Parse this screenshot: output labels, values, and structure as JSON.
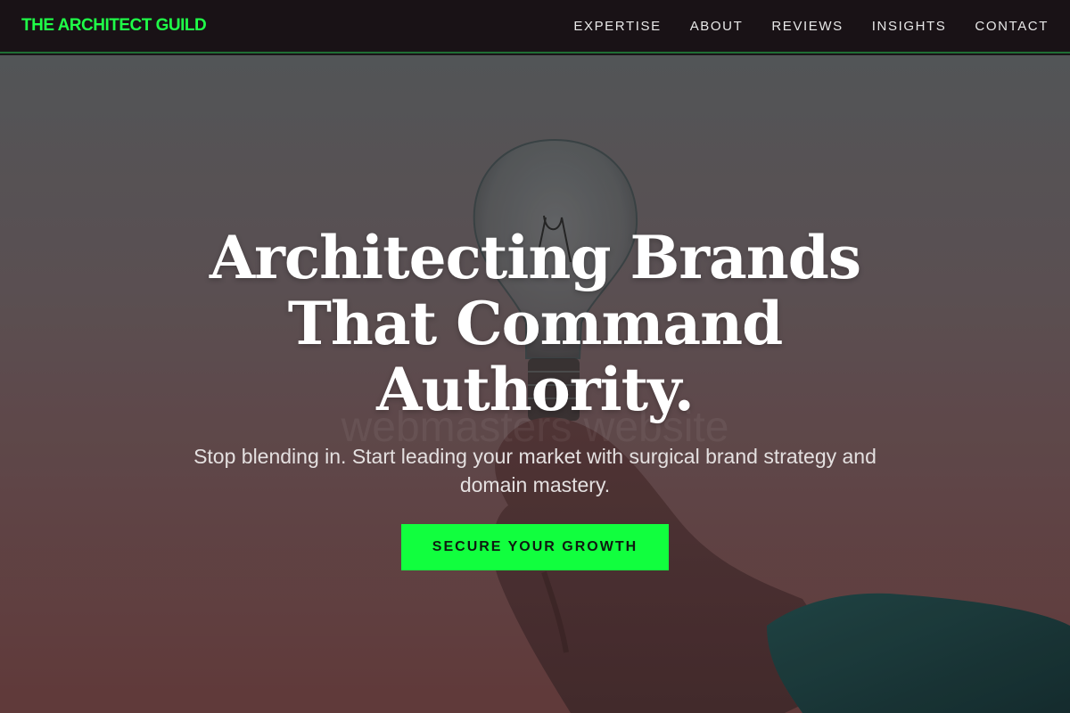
{
  "nav": {
    "logo": "THE ARCHITECT GUILD",
    "links": [
      "EXPERTISE",
      "ABOUT",
      "REVIEWS",
      "INSIGHTS",
      "CONTACT"
    ]
  },
  "hero": {
    "headline": "Architecting Brands That Command Authority.",
    "subhead": "Stop blending in. Start leading your market with surgical brand strategy and domain mastery.",
    "cta_label": "SECURE YOUR GROWTH",
    "watermark": "webmasters website"
  },
  "colors": {
    "accent": "#11ff3e",
    "logo": "#1fff48",
    "nav_bg": "#191216"
  },
  "icons": {
    "hero_image": "lightbulb-in-hand-photo"
  }
}
